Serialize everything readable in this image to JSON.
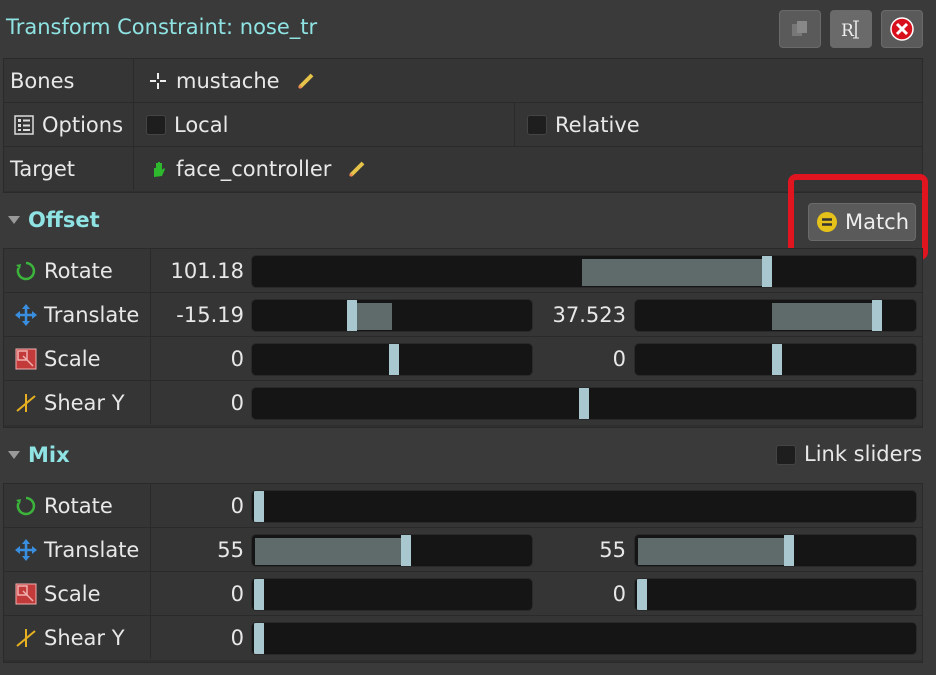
{
  "title": "Transform Constraint: nose_tr",
  "header_buttons": {
    "copy_icon": "copy-icon",
    "rename_icon": "rename-icon",
    "close_icon": "close-icon"
  },
  "bones": {
    "label": "Bones",
    "value": "mustache"
  },
  "options": {
    "label": "Options",
    "local": "Local",
    "relative": "Relative"
  },
  "target": {
    "label": "Target",
    "value": "face_controller"
  },
  "offset": {
    "title": "Offset",
    "match_label": "Match",
    "rotate": {
      "label": "Rotate",
      "value": "101.18",
      "level": 0.78
    },
    "translate": {
      "label": "Translate",
      "x": "-15.19",
      "y": "37.523"
    },
    "scale": {
      "label": "Scale",
      "x": "0",
      "y": "0"
    },
    "shear": {
      "label": "Shear Y",
      "value": "0"
    }
  },
  "mix": {
    "title": "Mix",
    "link_label": "Link sliders",
    "rotate": {
      "label": "Rotate",
      "value": "0"
    },
    "translate": {
      "label": "Translate",
      "x": "55",
      "y": "55"
    },
    "scale": {
      "label": "Scale",
      "x": "0",
      "y": "0"
    },
    "shear": {
      "label": "Shear Y",
      "value": "0"
    }
  },
  "colors": {
    "accent": "#8fe3e3",
    "highlight": "#e0151f"
  }
}
